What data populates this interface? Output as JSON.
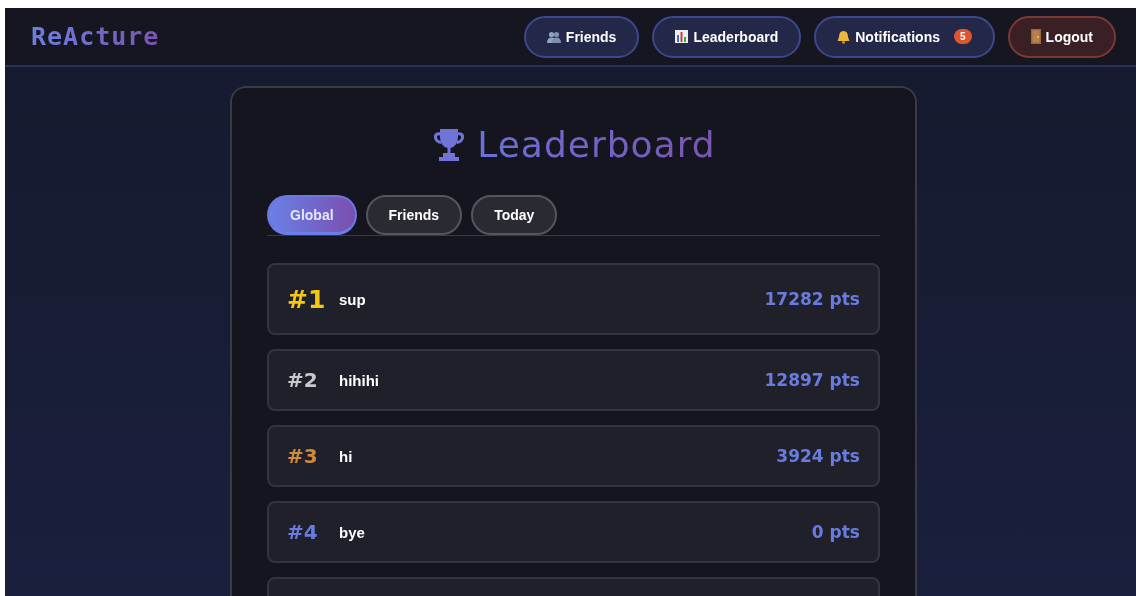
{
  "header": {
    "logo": "ReActure",
    "nav": [
      {
        "kind": "friends",
        "label": "Friends"
      },
      {
        "kind": "leaderboard",
        "label": "Leaderboard"
      },
      {
        "kind": "notifications",
        "label": "Notifications",
        "badge": "5"
      },
      {
        "kind": "logout",
        "label": "Logout"
      }
    ]
  },
  "panel": {
    "title": "Leaderboard",
    "tabs": [
      {
        "label": "Global",
        "selected": true
      },
      {
        "label": "Friends",
        "selected": false
      },
      {
        "label": "Today",
        "selected": false
      }
    ],
    "rows": [
      {
        "rank": "#1",
        "name": "sup",
        "points": "17282 pts",
        "color": "#f5c518"
      },
      {
        "rank": "#2",
        "name": "hihihi",
        "points": "12897 pts",
        "color": "#c8c8cc"
      },
      {
        "rank": "#3",
        "name": "hi",
        "points": "3924 pts",
        "color": "#d08a3a"
      },
      {
        "rank": "#4",
        "name": "bye",
        "points": "0 pts",
        "color": "#6a7be0"
      }
    ]
  }
}
